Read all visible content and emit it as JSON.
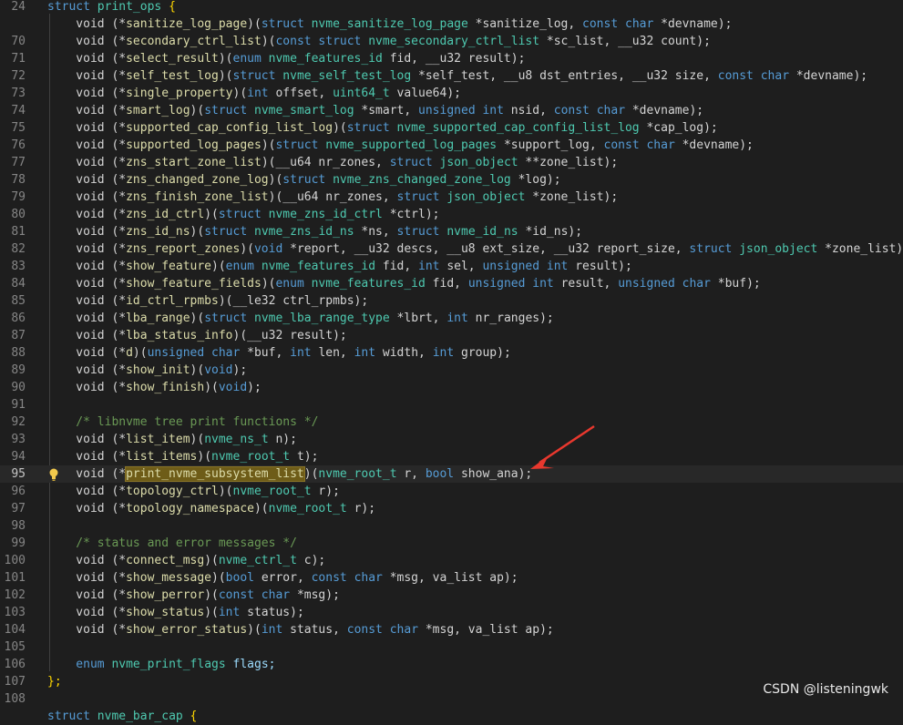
{
  "editor": {
    "lines": [
      {
        "num": "24",
        "tokens": [
          {
            "t": "struct ",
            "c": "kw"
          },
          {
            "t": "print_ops ",
            "c": "ty"
          },
          {
            "t": "{",
            "c": "br"
          }
        ]
      },
      {
        "num": "",
        "tokens": [
          {
            "t": "    void (*"
          },
          {
            "t": "sanitize_log_page",
            "c": "fn"
          },
          {
            "t": ")("
          },
          {
            "t": "struct ",
            "c": "kw"
          },
          {
            "t": "nvme_sanitize_log_page ",
            "c": "ty"
          },
          {
            "t": "*sanitize_log, "
          },
          {
            "t": "const char ",
            "c": "kw"
          },
          {
            "t": "*devname);"
          }
        ]
      },
      {
        "num": "70",
        "tokens": [
          {
            "t": "    void (*"
          },
          {
            "t": "secondary_ctrl_list",
            "c": "fn"
          },
          {
            "t": ")("
          },
          {
            "t": "const struct ",
            "c": "kw"
          },
          {
            "t": "nvme_secondary_ctrl_list ",
            "c": "ty"
          },
          {
            "t": "*sc_list, __u32 count);"
          }
        ]
      },
      {
        "num": "71",
        "tokens": [
          {
            "t": "    void (*"
          },
          {
            "t": "select_result",
            "c": "fn"
          },
          {
            "t": ")("
          },
          {
            "t": "enum ",
            "c": "kw"
          },
          {
            "t": "nvme_features_id ",
            "c": "ty"
          },
          {
            "t": "fid, __u32 result);"
          }
        ]
      },
      {
        "num": "72",
        "tokens": [
          {
            "t": "    void (*"
          },
          {
            "t": "self_test_log",
            "c": "fn"
          },
          {
            "t": ")("
          },
          {
            "t": "struct ",
            "c": "kw"
          },
          {
            "t": "nvme_self_test_log ",
            "c": "ty"
          },
          {
            "t": "*self_test, __u8 dst_entries, __u32 size, "
          },
          {
            "t": "const char ",
            "c": "kw"
          },
          {
            "t": "*devname);"
          }
        ]
      },
      {
        "num": "73",
        "tokens": [
          {
            "t": "    void (*"
          },
          {
            "t": "single_property",
            "c": "fn"
          },
          {
            "t": ")("
          },
          {
            "t": "int ",
            "c": "kw"
          },
          {
            "t": "offset, "
          },
          {
            "t": "uint64_t ",
            "c": "ty"
          },
          {
            "t": "value64);"
          }
        ]
      },
      {
        "num": "74",
        "tokens": [
          {
            "t": "    void (*"
          },
          {
            "t": "smart_log",
            "c": "fn"
          },
          {
            "t": ")("
          },
          {
            "t": "struct ",
            "c": "kw"
          },
          {
            "t": "nvme_smart_log ",
            "c": "ty"
          },
          {
            "t": "*smart, "
          },
          {
            "t": "unsigned int ",
            "c": "kw"
          },
          {
            "t": "nsid, "
          },
          {
            "t": "const char ",
            "c": "kw"
          },
          {
            "t": "*devname);"
          }
        ]
      },
      {
        "num": "75",
        "tokens": [
          {
            "t": "    void (*"
          },
          {
            "t": "supported_cap_config_list_log",
            "c": "fn"
          },
          {
            "t": ")("
          },
          {
            "t": "struct ",
            "c": "kw"
          },
          {
            "t": "nvme_supported_cap_config_list_log ",
            "c": "ty"
          },
          {
            "t": "*cap_log);"
          }
        ]
      },
      {
        "num": "76",
        "tokens": [
          {
            "t": "    void (*"
          },
          {
            "t": "supported_log_pages",
            "c": "fn"
          },
          {
            "t": ")("
          },
          {
            "t": "struct ",
            "c": "kw"
          },
          {
            "t": "nvme_supported_log_pages ",
            "c": "ty"
          },
          {
            "t": "*support_log, "
          },
          {
            "t": "const char ",
            "c": "kw"
          },
          {
            "t": "*devname);"
          }
        ]
      },
      {
        "num": "77",
        "tokens": [
          {
            "t": "    void (*"
          },
          {
            "t": "zns_start_zone_list",
            "c": "fn"
          },
          {
            "t": ")(__u64 nr_zones, "
          },
          {
            "t": "struct ",
            "c": "kw"
          },
          {
            "t": "json_object ",
            "c": "ty"
          },
          {
            "t": "**zone_list);"
          }
        ]
      },
      {
        "num": "78",
        "tokens": [
          {
            "t": "    void (*"
          },
          {
            "t": "zns_changed_zone_log",
            "c": "fn"
          },
          {
            "t": ")("
          },
          {
            "t": "struct ",
            "c": "kw"
          },
          {
            "t": "nvme_zns_changed_zone_log ",
            "c": "ty"
          },
          {
            "t": "*log);"
          }
        ]
      },
      {
        "num": "79",
        "tokens": [
          {
            "t": "    void (*"
          },
          {
            "t": "zns_finish_zone_list",
            "c": "fn"
          },
          {
            "t": ")(__u64 nr_zones, "
          },
          {
            "t": "struct ",
            "c": "kw"
          },
          {
            "t": "json_object ",
            "c": "ty"
          },
          {
            "t": "*zone_list);"
          }
        ]
      },
      {
        "num": "80",
        "tokens": [
          {
            "t": "    void (*"
          },
          {
            "t": "zns_id_ctrl",
            "c": "fn"
          },
          {
            "t": ")("
          },
          {
            "t": "struct ",
            "c": "kw"
          },
          {
            "t": "nvme_zns_id_ctrl ",
            "c": "ty"
          },
          {
            "t": "*ctrl);"
          }
        ]
      },
      {
        "num": "81",
        "tokens": [
          {
            "t": "    void (*"
          },
          {
            "t": "zns_id_ns",
            "c": "fn"
          },
          {
            "t": ")("
          },
          {
            "t": "struct ",
            "c": "kw"
          },
          {
            "t": "nvme_zns_id_ns ",
            "c": "ty"
          },
          {
            "t": "*ns, "
          },
          {
            "t": "struct ",
            "c": "kw"
          },
          {
            "t": "nvme_id_ns ",
            "c": "ty"
          },
          {
            "t": "*id_ns);"
          }
        ]
      },
      {
        "num": "82",
        "tokens": [
          {
            "t": "    void (*"
          },
          {
            "t": "zns_report_zones",
            "c": "fn"
          },
          {
            "t": ")("
          },
          {
            "t": "void ",
            "c": "kw"
          },
          {
            "t": "*report, __u32 descs, __u8 ext_size, __u32 report_size, "
          },
          {
            "t": "struct ",
            "c": "kw"
          },
          {
            "t": "json_object ",
            "c": "ty"
          },
          {
            "t": "*zone_list);"
          }
        ]
      },
      {
        "num": "83",
        "tokens": [
          {
            "t": "    void (*"
          },
          {
            "t": "show_feature",
            "c": "fn"
          },
          {
            "t": ")("
          },
          {
            "t": "enum ",
            "c": "kw"
          },
          {
            "t": "nvme_features_id ",
            "c": "ty"
          },
          {
            "t": "fid, "
          },
          {
            "t": "int ",
            "c": "kw"
          },
          {
            "t": "sel, "
          },
          {
            "t": "unsigned int ",
            "c": "kw"
          },
          {
            "t": "result);"
          }
        ]
      },
      {
        "num": "84",
        "tokens": [
          {
            "t": "    void (*"
          },
          {
            "t": "show_feature_fields",
            "c": "fn"
          },
          {
            "t": ")("
          },
          {
            "t": "enum ",
            "c": "kw"
          },
          {
            "t": "nvme_features_id ",
            "c": "ty"
          },
          {
            "t": "fid, "
          },
          {
            "t": "unsigned int ",
            "c": "kw"
          },
          {
            "t": "result, "
          },
          {
            "t": "unsigned char ",
            "c": "kw"
          },
          {
            "t": "*buf);"
          }
        ]
      },
      {
        "num": "85",
        "tokens": [
          {
            "t": "    void (*"
          },
          {
            "t": "id_ctrl_rpmbs",
            "c": "fn"
          },
          {
            "t": ")(__le32 ctrl_rpmbs);"
          }
        ]
      },
      {
        "num": "86",
        "tokens": [
          {
            "t": "    void (*"
          },
          {
            "t": "lba_range",
            "c": "fn"
          },
          {
            "t": ")("
          },
          {
            "t": "struct ",
            "c": "kw"
          },
          {
            "t": "nvme_lba_range_type ",
            "c": "ty"
          },
          {
            "t": "*lbrt, "
          },
          {
            "t": "int ",
            "c": "kw"
          },
          {
            "t": "nr_ranges);"
          }
        ]
      },
      {
        "num": "87",
        "tokens": [
          {
            "t": "    void (*"
          },
          {
            "t": "lba_status_info",
            "c": "fn"
          },
          {
            "t": ")(__u32 result);"
          }
        ]
      },
      {
        "num": "88",
        "tokens": [
          {
            "t": "    void (*"
          },
          {
            "t": "d",
            "c": "fn"
          },
          {
            "t": ")("
          },
          {
            "t": "unsigned char ",
            "c": "kw"
          },
          {
            "t": "*buf, "
          },
          {
            "t": "int ",
            "c": "kw"
          },
          {
            "t": "len, "
          },
          {
            "t": "int ",
            "c": "kw"
          },
          {
            "t": "width, "
          },
          {
            "t": "int ",
            "c": "kw"
          },
          {
            "t": "group);"
          }
        ]
      },
      {
        "num": "89",
        "tokens": [
          {
            "t": "    void (*"
          },
          {
            "t": "show_init",
            "c": "fn"
          },
          {
            "t": ")("
          },
          {
            "t": "void",
            "c": "kw"
          },
          {
            "t": ");"
          }
        ]
      },
      {
        "num": "90",
        "tokens": [
          {
            "t": "    void (*"
          },
          {
            "t": "show_finish",
            "c": "fn"
          },
          {
            "t": ")("
          },
          {
            "t": "void",
            "c": "kw"
          },
          {
            "t": ");"
          }
        ]
      },
      {
        "num": "91",
        "tokens": []
      },
      {
        "num": "92",
        "tokens": [
          {
            "t": "    /* libnvme tree print functions */",
            "c": "cm"
          }
        ]
      },
      {
        "num": "93",
        "tokens": [
          {
            "t": "    void (*"
          },
          {
            "t": "list_item",
            "c": "fn"
          },
          {
            "t": ")("
          },
          {
            "t": "nvme_ns_t ",
            "c": "ty"
          },
          {
            "t": "n);"
          }
        ]
      },
      {
        "num": "94",
        "tokens": [
          {
            "t": "    void (*"
          },
          {
            "t": "list_items",
            "c": "fn"
          },
          {
            "t": ")("
          },
          {
            "t": "nvme_root_t ",
            "c": "ty"
          },
          {
            "t": "t);"
          }
        ]
      },
      {
        "num": "95",
        "current": true,
        "tokens": [
          {
            "t": "    void (*"
          },
          {
            "t": "print_nvme_subsystem_list",
            "c": "hl"
          },
          {
            "t": ")("
          },
          {
            "t": "nvme_root_t ",
            "c": "ty"
          },
          {
            "t": "r, "
          },
          {
            "t": "bool ",
            "c": "kw"
          },
          {
            "t": "show_ana);"
          }
        ]
      },
      {
        "num": "96",
        "tokens": [
          {
            "t": "    void (*"
          },
          {
            "t": "topology_ctrl",
            "c": "fn"
          },
          {
            "t": ")("
          },
          {
            "t": "nvme_root_t ",
            "c": "ty"
          },
          {
            "t": "r);"
          }
        ]
      },
      {
        "num": "97",
        "tokens": [
          {
            "t": "    void (*"
          },
          {
            "t": "topology_namespace",
            "c": "fn"
          },
          {
            "t": ")("
          },
          {
            "t": "nvme_root_t ",
            "c": "ty"
          },
          {
            "t": "r);"
          }
        ]
      },
      {
        "num": "98",
        "tokens": []
      },
      {
        "num": "99",
        "tokens": [
          {
            "t": "    /* status and error messages */",
            "c": "cm"
          }
        ]
      },
      {
        "num": "100",
        "tokens": [
          {
            "t": "    void (*"
          },
          {
            "t": "connect_msg",
            "c": "fn"
          },
          {
            "t": ")("
          },
          {
            "t": "nvme_ctrl_t ",
            "c": "ty"
          },
          {
            "t": "c);"
          }
        ]
      },
      {
        "num": "101",
        "tokens": [
          {
            "t": "    void (*"
          },
          {
            "t": "show_message",
            "c": "fn"
          },
          {
            "t": ")("
          },
          {
            "t": "bool ",
            "c": "kw"
          },
          {
            "t": "error, "
          },
          {
            "t": "const char ",
            "c": "kw"
          },
          {
            "t": "*msg, va_list ap);"
          }
        ]
      },
      {
        "num": "102",
        "tokens": [
          {
            "t": "    void (*"
          },
          {
            "t": "show_perror",
            "c": "fn"
          },
          {
            "t": ")("
          },
          {
            "t": "const char ",
            "c": "kw"
          },
          {
            "t": "*msg);"
          }
        ]
      },
      {
        "num": "103",
        "tokens": [
          {
            "t": "    void (*"
          },
          {
            "t": "show_status",
            "c": "fn"
          },
          {
            "t": ")("
          },
          {
            "t": "int ",
            "c": "kw"
          },
          {
            "t": "status);"
          }
        ]
      },
      {
        "num": "104",
        "tokens": [
          {
            "t": "    void (*"
          },
          {
            "t": "show_error_status",
            "c": "fn"
          },
          {
            "t": ")("
          },
          {
            "t": "int ",
            "c": "kw"
          },
          {
            "t": "status, "
          },
          {
            "t": "const char ",
            "c": "kw"
          },
          {
            "t": "*msg, va_list ap);"
          }
        ]
      },
      {
        "num": "105",
        "tokens": []
      },
      {
        "num": "106",
        "tokens": [
          {
            "t": "    enum ",
            "c": "kw"
          },
          {
            "t": "nvme_print_flags ",
            "c": "ty"
          },
          {
            "t": "flags;",
            "c": "id"
          }
        ]
      },
      {
        "num": "107",
        "tokens": [
          {
            "t": "};",
            "c": "br"
          }
        ]
      },
      {
        "num": "108",
        "tokens": []
      },
      {
        "num": "",
        "tokens": [
          {
            "t": "struct ",
            "c": "kw"
          },
          {
            "t": "nvme_bar_cap ",
            "c": "ty"
          },
          {
            "t": "{",
            "c": "br"
          }
        ]
      }
    ]
  },
  "watermark": "CSDN @listeningwk",
  "icons": {
    "lightbulb": "lightbulb-icon",
    "arrow": "red-arrow-annotation"
  },
  "colors": {
    "arrow": "#e8382e",
    "highlight": "#6e5c18"
  }
}
